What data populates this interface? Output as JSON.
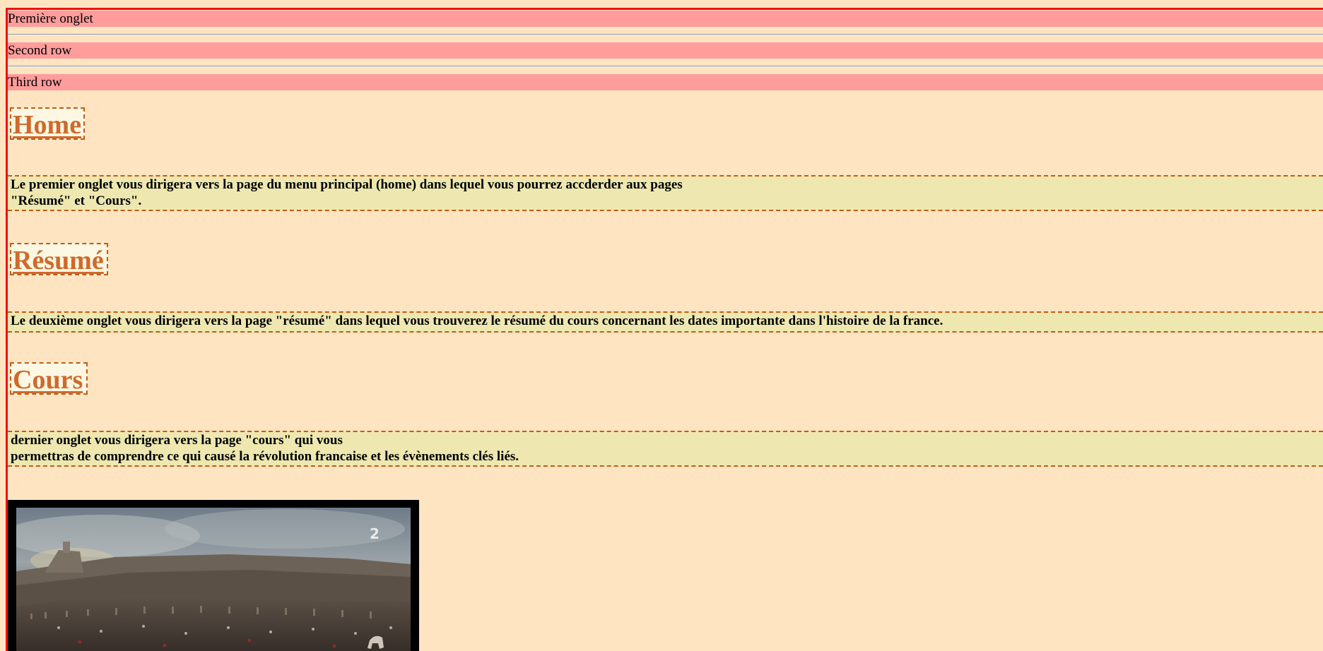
{
  "tabs": [
    {
      "label": "Première onglet"
    },
    {
      "label": "Second row"
    },
    {
      "label": "Third row"
    }
  ],
  "sections": [
    {
      "heading": "Home",
      "lines": [
        "Le premier onglet vous dirigera vers la page du menu principal (home) dans lequel vous pourrez accderder aux pages",
        "\"Résumé\" et \"Cours\"."
      ]
    },
    {
      "heading": "Résumé",
      "lines": [
        "Le deuxième onglet vous dirigera vers la page \"résumé\" dans lequel vous trouverez le résumé du cours concernant les dates importante dans l'histoire de la france."
      ]
    },
    {
      "heading": "Cours",
      "lines": [
        "dernier onglet vous dirigera vers la page \"cours\" qui vous",
        "permettras de comprendre ce qui causé la révolution francaise et les évènements clés liés."
      ]
    }
  ],
  "media": {
    "channel_logo": "2"
  },
  "colors": {
    "page_background": "#ffe4c2",
    "row_background": "#ff9c9c",
    "frame_border": "#ee1111",
    "heading_text": "#cf6a2c",
    "heading_background": "#fbf7e2",
    "dashed_border": "#c55a14",
    "paragraph_background": "#eee8b0"
  }
}
